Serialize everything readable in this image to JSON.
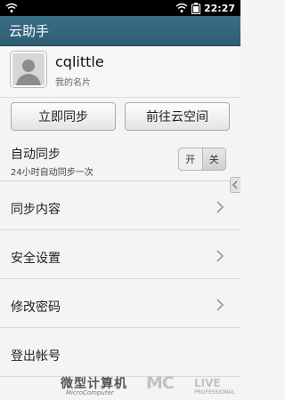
{
  "status": {
    "time": "22:27"
  },
  "header": {
    "title": "云助手"
  },
  "profile": {
    "username": "cqlittle",
    "card_label": "我的名片"
  },
  "actions": {
    "sync_now": "立即同步",
    "go_cloud": "前往云空间"
  },
  "auto_sync": {
    "title": "自动同步",
    "subtitle": "24小时自动同步一次",
    "toggle_on": "开",
    "toggle_off": "关",
    "state": "off"
  },
  "menu": [
    {
      "label": "同步内容"
    },
    {
      "label": "安全设置"
    },
    {
      "label": "修改密码"
    },
    {
      "label": "登出帐号"
    }
  ],
  "watermark": {
    "cn": "微型计算机",
    "en": "MicroComputer",
    "brand": "MC",
    "live": "LIVE",
    "pro": "PROFESSIONAL"
  }
}
